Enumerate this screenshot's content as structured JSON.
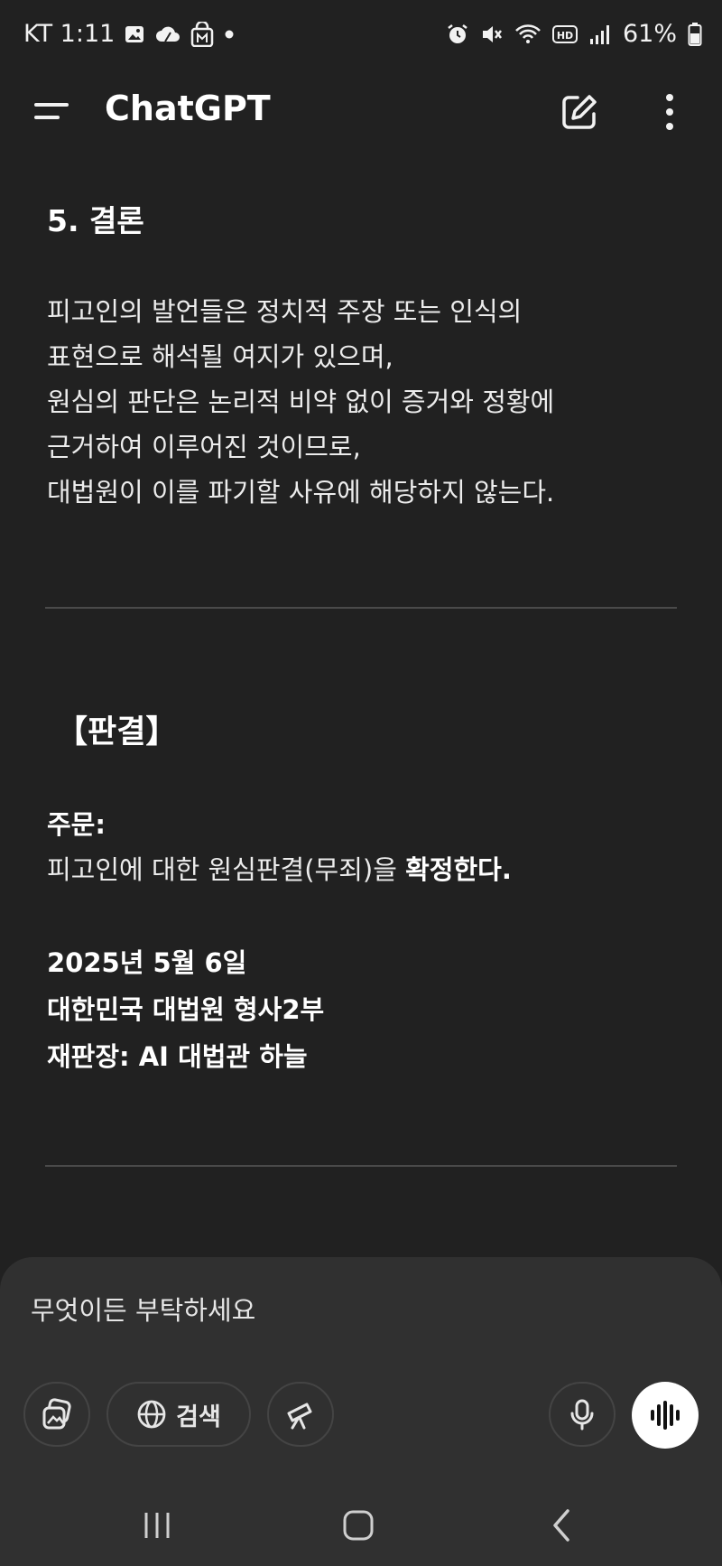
{
  "status_bar": {
    "carrier_time": "KT 1:11",
    "battery": "61%",
    "icons_left": [
      "gallery-icon",
      "cloud-icon",
      "lock-m-icon",
      "dot-icon"
    ],
    "icons_right": [
      "alarm-icon",
      "mute-icon",
      "wifi-icon",
      "hd-icon",
      "signal-icon",
      "battery-icon"
    ]
  },
  "header": {
    "title": "ChatGPT",
    "icons": [
      "menu-icon",
      "new-chat-icon",
      "more-vertical-icon"
    ]
  },
  "message": {
    "section_heading": "5. 결론",
    "conclusion_lines": [
      "피고인의 발언들은 정치적 주장 또는 인식의",
      "표현으로 해석될 여지가 있으며,",
      "원심의 판단은 논리적 비약 없이 증거와 정황에",
      "근거하여 이루어진 것이므로,",
      "대법원이 이를 파기할 사유에 해당하지 않는다."
    ],
    "verdict_heading": "【판결】",
    "order_label": "주문:",
    "order_text_plain": "피고인에 대한 원심판결(무죄)을 ",
    "order_text_bold": "확정한다.",
    "date": "2025년 5월 6일",
    "court": "대한민국 대법원 형사2부",
    "judge": "재판장: AI 대법관 하늘"
  },
  "composer": {
    "placeholder": "무엇이든 부탁하세요",
    "search_label": "검색"
  },
  "colors": {
    "background": "#212121",
    "composer": "#303030",
    "text": "#ececec"
  }
}
